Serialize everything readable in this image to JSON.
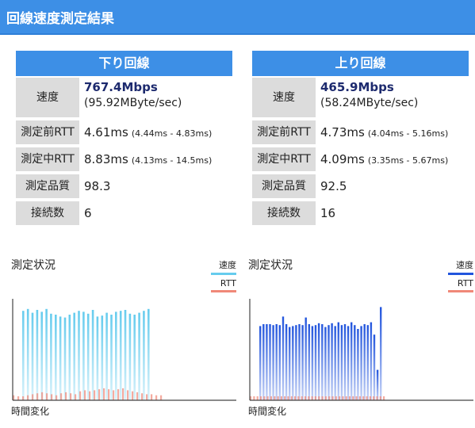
{
  "header": {
    "title": "回線速度測定結果"
  },
  "panels": [
    {
      "title": "下り回線",
      "speed": {
        "label": "速度",
        "main": "767.4Mbps",
        "sub": "(95.92MByte/sec)"
      },
      "rtt_before": {
        "label": "測定前RTT",
        "main": "4.61ms",
        "range": "(4.44ms - 4.83ms)"
      },
      "rtt_during": {
        "label": "測定中RTT",
        "main": "8.83ms",
        "range": "(4.13ms - 14.5ms)"
      },
      "quality": {
        "label": "測定品質",
        "value": "98.3"
      },
      "connections": {
        "label": "接続数",
        "value": "6"
      }
    },
    {
      "title": "上り回線",
      "speed": {
        "label": "速度",
        "main": "465.9Mbps",
        "sub": "(58.24MByte/sec)"
      },
      "rtt_before": {
        "label": "測定前RTT",
        "main": "4.73ms",
        "range": "(4.04ms - 5.16ms)"
      },
      "rtt_during": {
        "label": "測定中RTT",
        "main": "4.09ms",
        "range": "(3.35ms - 5.67ms)"
      },
      "quality": {
        "label": "測定品質",
        "value": "92.5"
      },
      "connections": {
        "label": "接続数",
        "value": "16"
      }
    }
  ],
  "charts": [
    {
      "title": "測定状況",
      "xlabel": "時間変化",
      "legend": [
        {
          "label": "速度",
          "color": "#66ccee"
        },
        {
          "label": "RTT",
          "color": "#f08878"
        }
      ],
      "speed_color": "#66ccee",
      "rtt_color": "#f08878",
      "speed": [
        0.94,
        0.96,
        0.92,
        0.95,
        0.93,
        0.96,
        0.91,
        0.9,
        0.88,
        0.87,
        0.9,
        0.92,
        0.94,
        0.93,
        0.91,
        0.95,
        0.88,
        0.89,
        0.92,
        0.9,
        0.93,
        0.94,
        0.95,
        0.91,
        0.9,
        0.92,
        0.94,
        0.96
      ],
      "rtt": [
        0.05,
        0.04,
        0.04,
        0.05,
        0.06,
        0.07,
        0.08,
        0.07,
        0.06,
        0.05,
        0.07,
        0.08,
        0.07,
        0.06,
        0.09,
        0.1,
        0.09,
        0.1,
        0.11,
        0.12,
        0.11,
        0.1,
        0.11,
        0.12,
        0.1,
        0.09,
        0.08,
        0.07,
        0.06,
        0.06,
        0.05,
        0.05
      ]
    },
    {
      "title": "測定状況",
      "xlabel": "時間変化",
      "legend": [
        {
          "label": "速度",
          "color": "#2255dd"
        },
        {
          "label": "RTT",
          "color": "#f08878"
        }
      ],
      "speed_color": "#2255dd",
      "rtt_color": "#f08878",
      "speed": [
        0.78,
        0.8,
        0.8,
        0.8,
        0.79,
        0.8,
        0.79,
        0.88,
        0.8,
        0.77,
        0.78,
        0.79,
        0.8,
        0.79,
        0.87,
        0.8,
        0.78,
        0.79,
        0.81,
        0.8,
        0.77,
        0.79,
        0.81,
        0.78,
        0.82,
        0.79,
        0.8,
        0.78,
        0.82,
        0.79,
        0.75,
        0.78,
        0.8,
        0.79,
        0.82,
        0.69,
        0.32,
        0.98
      ],
      "rtt": [
        0.04,
        0.04,
        0.04,
        0.04,
        0.04,
        0.04,
        0.04,
        0.04,
        0.04,
        0.04,
        0.04,
        0.04,
        0.04,
        0.04,
        0.04,
        0.04,
        0.04,
        0.04,
        0.04,
        0.04,
        0.04,
        0.04,
        0.04,
        0.04,
        0.04,
        0.04,
        0.04,
        0.04,
        0.04,
        0.04,
        0.04,
        0.04,
        0.04,
        0.04,
        0.04,
        0.04,
        0.04,
        0.04,
        0.04,
        0.04
      ]
    }
  ]
}
